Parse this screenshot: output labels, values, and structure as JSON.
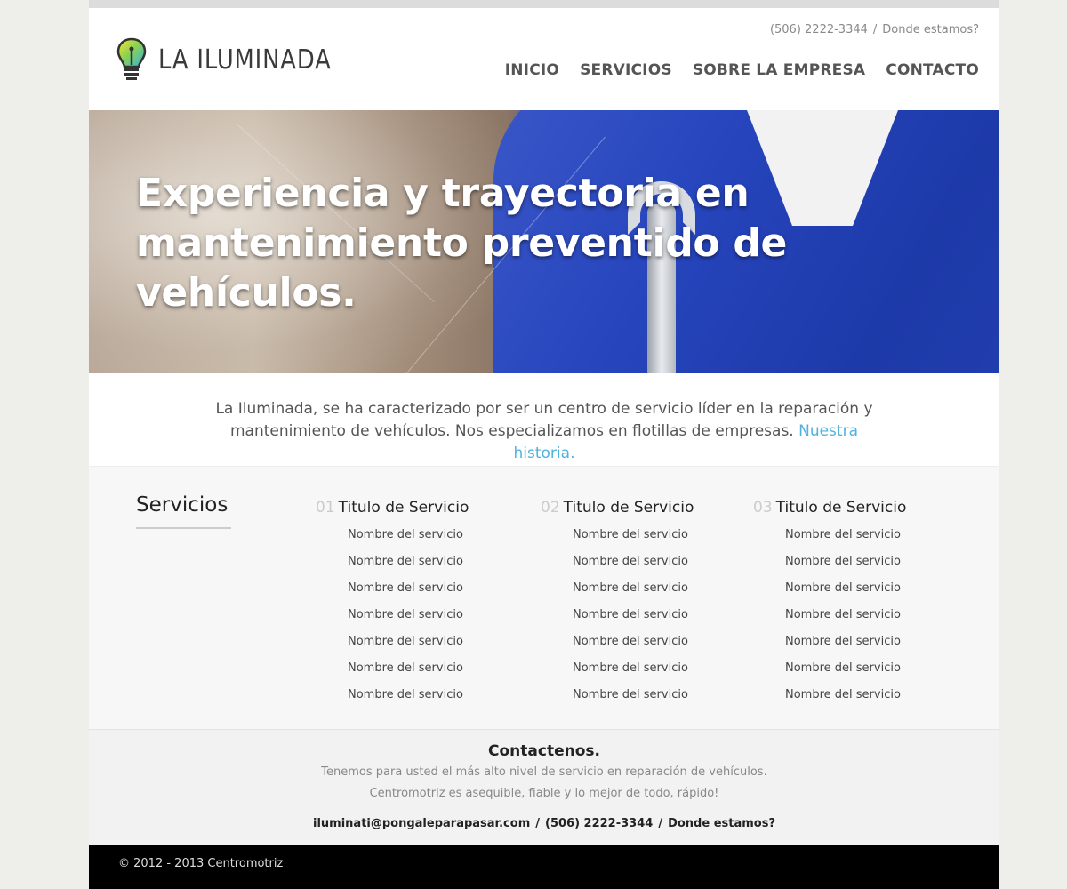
{
  "brand": {
    "name": "LA ILUMINADA",
    "logo_icon": "lightbulb-icon"
  },
  "header": {
    "phone": "(506) 2222-3344",
    "separator": "/",
    "location_link": "Donde estamos?"
  },
  "nav": {
    "items": [
      {
        "label": "INICIO"
      },
      {
        "label": "SERVICIOS"
      },
      {
        "label": "SOBRE LA EMPRESA"
      },
      {
        "label": "CONTACTO"
      }
    ]
  },
  "hero": {
    "headline": "Experiencia y trayectoria en mantenimiento preventido de vehículos."
  },
  "intro": {
    "text": "La Iluminada, se ha caracterizado por ser un centro de servicio líder en la reparación y mantenimiento de vehículos. Nos especializamos en flotillas de empresas.",
    "link": "Nuestra historia."
  },
  "services": {
    "title": "Servicios",
    "columns": [
      {
        "num": "01",
        "title": "Titulo de Servicio",
        "items": [
          "Nombre del servicio",
          "Nombre del servicio",
          "Nombre del servicio",
          "Nombre del servicio",
          "Nombre del servicio",
          "Nombre del servicio",
          "Nombre del servicio"
        ]
      },
      {
        "num": "02",
        "title": "Titulo de Servicio",
        "items": [
          "Nombre del servicio",
          "Nombre del servicio",
          "Nombre del servicio",
          "Nombre del servicio",
          "Nombre del servicio",
          "Nombre del servicio",
          "Nombre del servicio"
        ]
      },
      {
        "num": "03",
        "title": "Titulo de Servicio",
        "items": [
          "Nombre del servicio",
          "Nombre del servicio",
          "Nombre del servicio",
          "Nombre del servicio",
          "Nombre del servicio",
          "Nombre del servicio",
          "Nombre del servicio"
        ]
      }
    ]
  },
  "contact": {
    "title": "Contactenos.",
    "line1": "Tenemos para usted el más alto nivel de servicio en reparación de vehículos.",
    "line2": "Centromotriz es asequible, fiable y lo mejor de todo, rápido!",
    "email": "iluminati@pongaleparapasar.com",
    "phone": "(506) 2222-3344",
    "location": "Donde estamos?",
    "separator": "/"
  },
  "footer": {
    "copyright": "© 2012 - 2013 Centromotriz"
  },
  "colors": {
    "accent_link": "#4fb3de",
    "footer_bg": "#000000",
    "nav_text": "#555555"
  }
}
